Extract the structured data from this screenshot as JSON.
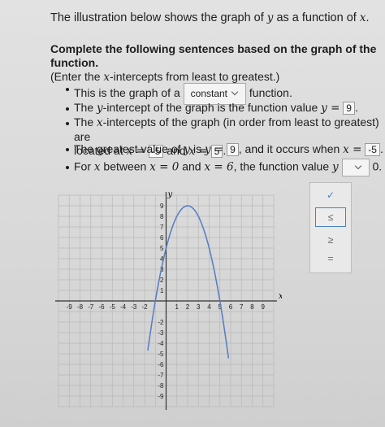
{
  "intro_prefix": "The illustration below shows the graph of ",
  "intro_y": "y",
  "intro_mid": " as a function of ",
  "intro_x": "x",
  "intro_end": ".",
  "instr_line1": "Complete the following sentences based on the graph of the function.",
  "instr_line2_a": "(Enter the ",
  "instr_line2_x": "x",
  "instr_line2_b": "-intercepts from least to greatest.)",
  "items": {
    "type_prefix": "This is the graph of a",
    "type_value": "constant",
    "type_suffix": "function.",
    "yint_prefix": "The ",
    "yint_var": "y",
    "yint_mid": "-intercept of the graph is the function value ",
    "yint_eq": "y =",
    "yint_value": "9",
    "yint_end": ".",
    "xint_prefix": "The ",
    "xint_var": "x",
    "xint_mid": "-intercepts of the graph (in order from least to greatest) are",
    "xint_line2": "located at ",
    "xint_eq1": "x =",
    "xint_value1": "-5",
    "xint_and": "and",
    "xint_eq2": "x =",
    "xint_value2": "5",
    "xint_end": ".",
    "max_prefix": "The greatest value of ",
    "max_var": "y",
    "max_is": " is ",
    "max_eq": "y =",
    "max_value": "9",
    "max_mid": ", and it occurs when ",
    "max_eq2": "x =",
    "max_value2": "-5",
    "max_end": ".",
    "for_prefix": "For ",
    "for_var": "x",
    "for_mid": " between ",
    "for_eq1": "x = 0",
    "for_and": " and ",
    "for_eq2": "x = 6",
    "for_suffix": ", the function value ",
    "for_y": "y",
    "for_end": "0."
  },
  "dropdown_options": [
    "✓",
    "≤",
    "≥",
    "="
  ],
  "graph": {
    "y_axis_label": "y",
    "x_axis_label": "x",
    "x_ticks": [
      "-9",
      "-8",
      "-7",
      "-6",
      "-5",
      "-4",
      "-3",
      "-2",
      "1",
      "2",
      "3",
      "4",
      "5",
      "6",
      "7",
      "8",
      "9"
    ],
    "y_ticks_pos": [
      "9",
      "8",
      "7",
      "6",
      "5",
      "4",
      "3",
      "2",
      "1"
    ],
    "y_ticks_neg": [
      "-2",
      "-3",
      "-4",
      "-5",
      "-6",
      "-7",
      "-8",
      "-9"
    ],
    "curve_color": "#5b7fc4",
    "axis_color": "#333333",
    "grid_color": "#b8b8b8"
  }
}
